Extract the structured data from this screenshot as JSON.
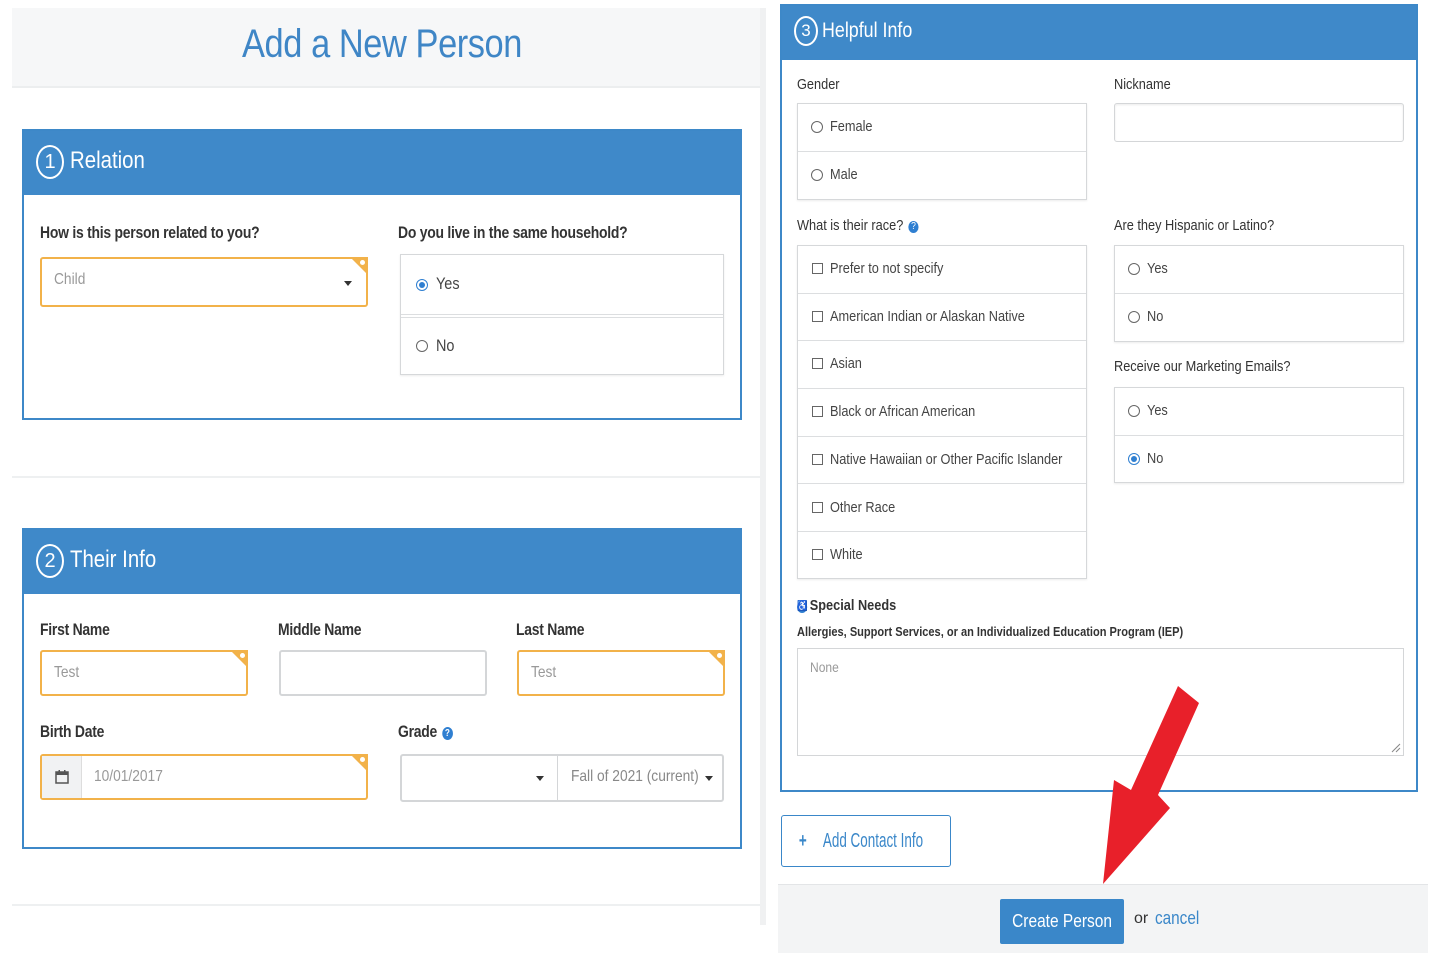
{
  "page_title": "Add a New Person",
  "relation": {
    "number": "1",
    "title": "Relation",
    "related_label": "How is this person related to you?",
    "related_value": "Child",
    "household_label": "Do you live in the same household?",
    "household_options": [
      {
        "label": "Yes",
        "selected": true
      },
      {
        "label": "No",
        "selected": false
      }
    ]
  },
  "their_info": {
    "number": "2",
    "title": "Their Info",
    "first_name_label": "First Name",
    "first_name_value": "Test",
    "middle_name_label": "Middle Name",
    "middle_name_value": "",
    "last_name_label": "Last Name",
    "last_name_value": "Test",
    "birth_date_label": "Birth Date",
    "birth_date_value": "10/01/2017",
    "grade_label": "Grade",
    "grade_value": "",
    "term_value": "Fall of 2021 (current)"
  },
  "helpful_info": {
    "number": "3",
    "title": "Helpful Info",
    "gender_label": "Gender",
    "gender_options": [
      {
        "label": "Female",
        "selected": false
      },
      {
        "label": "Male",
        "selected": false
      }
    ],
    "nickname_label": "Nickname",
    "nickname_value": "",
    "race_label": "What is their race?",
    "race_options": [
      "Prefer to not specify",
      "American Indian or Alaskan Native",
      "Asian",
      "Black or African American",
      "Native Hawaiian or Other Pacific Islander",
      "Other Race",
      "White"
    ],
    "hispanic_label": "Are they Hispanic or Latino?",
    "hispanic_options": [
      {
        "label": "Yes",
        "selected": false
      },
      {
        "label": "No",
        "selected": false
      }
    ],
    "marketing_label": "Receive our Marketing Emails?",
    "marketing_options": [
      {
        "label": "Yes",
        "selected": false
      },
      {
        "label": "No",
        "selected": true
      }
    ],
    "special_needs_label": "Special Needs",
    "special_needs_hint": "Allergies, Support Services, or an Individualized Education Program (IEP)",
    "special_needs_placeholder": "None"
  },
  "actions": {
    "add_contact": "Add Contact Info",
    "create": "Create Person",
    "or": "or",
    "cancel": "cancel"
  },
  "colors": {
    "primary": "#3f89c9",
    "required_border": "#f2b24a",
    "arrow": "#e8202a"
  }
}
